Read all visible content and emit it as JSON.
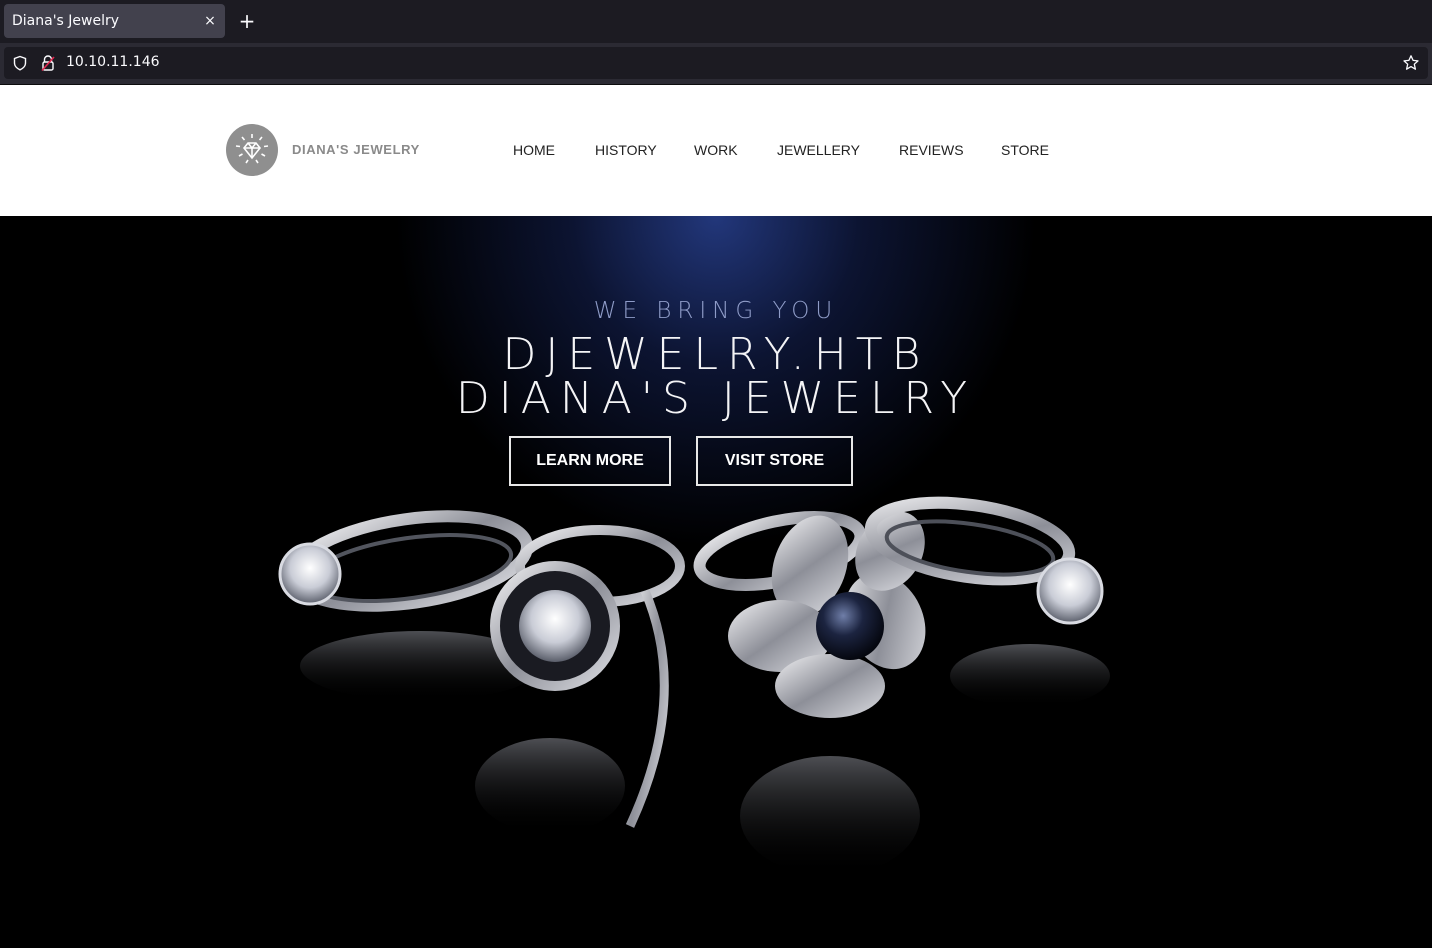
{
  "browser": {
    "tab_title": "Diana's Jewelry",
    "tab_close": "×",
    "new_tab": "+",
    "url": "10.10.11.146"
  },
  "header": {
    "logo_text": "DIANA'S JEWELRY",
    "nav": [
      "HOME",
      "HISTORY",
      "WORK",
      "JEWELLERY",
      "REVIEWS",
      "STORE"
    ]
  },
  "hero": {
    "subtitle": "WE BRING YOU",
    "title_line1": "DJEWELRY.HTB",
    "title_line2": "DIANA'S JEWELRY",
    "learn_more": "LEARN MORE",
    "visit_store": "VISIT STORE"
  },
  "colors": {
    "chrome_dark": "#1c1b22",
    "chrome_mid": "#2b2a33",
    "hero_blue": "#243a82",
    "logo_gray": "#8f8f8f"
  }
}
